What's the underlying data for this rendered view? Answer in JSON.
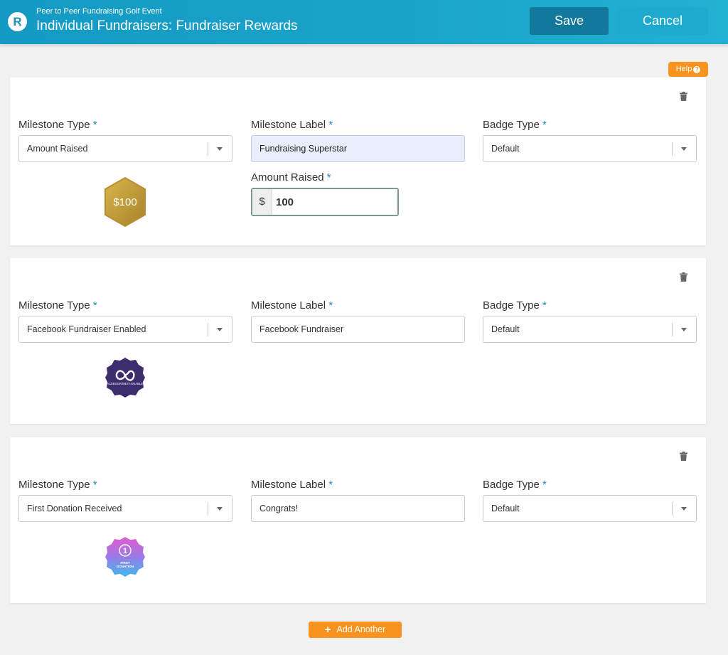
{
  "header": {
    "logo_letter": "R",
    "subtitle": "Peer to Peer Fundraising Golf Event",
    "title": "Individual Fundraisers: Fundraiser Rewards",
    "save_label": "Save",
    "cancel_label": "Cancel",
    "color": "#1aa4cb"
  },
  "help_label": "Help",
  "help_icon": "question-circle-icon",
  "labels": {
    "milestone_type": "Milestone Type",
    "milestone_label": "Milestone Label",
    "badge_type": "Badge Type",
    "amount_raised": "Amount Raised",
    "required": "*"
  },
  "rewards": [
    {
      "milestone_type": "Amount Raised",
      "milestone_label": "Fundraising Superstar",
      "badge_type": "Default",
      "amount_prefix": "$",
      "amount_value": "100",
      "badge_text": "$100"
    },
    {
      "milestone_type": "Facebook Fundraiser Enabled",
      "milestone_label": "Facebook Fundraiser",
      "badge_type": "Default",
      "badge_text": "FACEBOOK/META ENABLED"
    },
    {
      "milestone_type": "First Donation Received",
      "milestone_label": "Congrats!",
      "badge_type": "Default",
      "badge_number": "1",
      "badge_text": "FIRST DONATION"
    }
  ],
  "add_another_label": "Add Another",
  "colors": {
    "accent": "#f7931e",
    "save": "#12789c",
    "cancel": "#1ea9cf",
    "required": "#1a8fb8"
  }
}
